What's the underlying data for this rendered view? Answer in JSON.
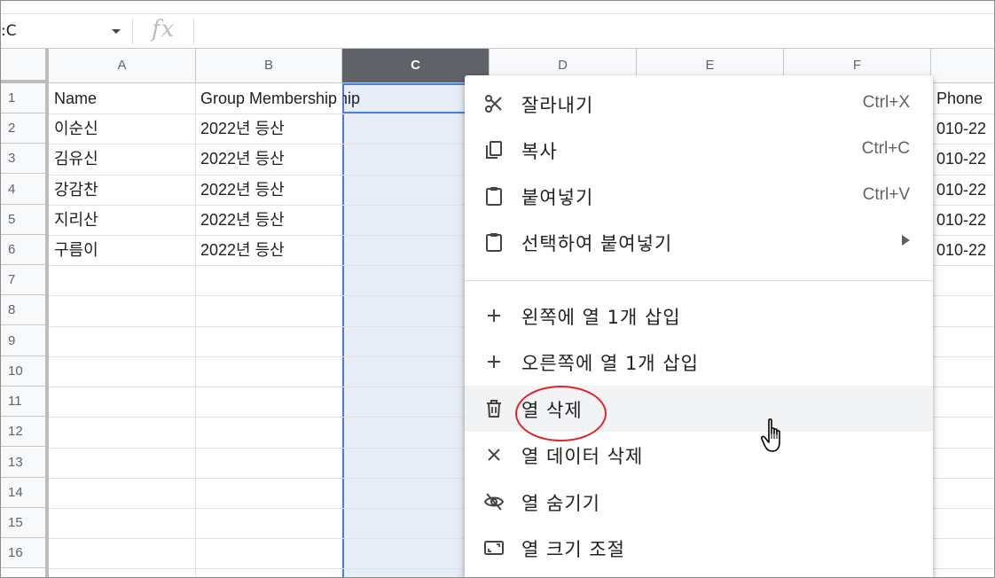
{
  "formula_bar": {
    "name_box": ":C",
    "fx_symbol": "fx"
  },
  "columns": [
    {
      "letter": "A",
      "selected": false
    },
    {
      "letter": "B",
      "selected": false
    },
    {
      "letter": "C",
      "selected": true
    },
    {
      "letter": "D",
      "selected": false
    },
    {
      "letter": "E",
      "selected": false
    },
    {
      "letter": "F",
      "selected": false
    }
  ],
  "rows": [
    "1",
    "2",
    "3",
    "4",
    "5",
    "6",
    "7",
    "8",
    "9",
    "10",
    "11",
    "12",
    "13",
    "14",
    "15",
    "16"
  ],
  "cells": {
    "header_a": "Name",
    "header_b": "Group Membership",
    "header_g": "Phone",
    "data": [
      {
        "name": "이순신",
        "group": "2022년 등산",
        "phone": "010-22"
      },
      {
        "name": "김유신",
        "group": "2022년 등산",
        "phone": "010-22"
      },
      {
        "name": "강감찬",
        "group": "2022년 등산",
        "phone": "010-22"
      },
      {
        "name": "지리산",
        "group": "2022년 등산",
        "phone": "010-22"
      },
      {
        "name": "구름이",
        "group": "2022년 등산",
        "phone": "010-22"
      }
    ]
  },
  "context_menu": {
    "items": [
      {
        "label": "잘라내기",
        "shortcut": "Ctrl+X",
        "icon": "scissors-icon"
      },
      {
        "label": "복사",
        "shortcut": "Ctrl+C",
        "icon": "copy-icon"
      },
      {
        "label": "붙여넣기",
        "shortcut": "Ctrl+V",
        "icon": "clipboard-icon"
      },
      {
        "label": "선택하여 붙여넣기",
        "shortcut": "",
        "icon": "clipboard-icon",
        "submenu": true
      },
      {
        "label": "왼쪽에 열 1개 삽입",
        "shortcut": "",
        "icon": "plus-icon"
      },
      {
        "label": "오른쪽에 열 1개 삽입",
        "shortcut": "",
        "icon": "plus-icon"
      },
      {
        "label": "열 삭제",
        "shortcut": "",
        "icon": "trash-icon",
        "highlighted": true
      },
      {
        "label": "열 데이터 삭제",
        "shortcut": "",
        "icon": "close-icon"
      },
      {
        "label": "열 숨기기",
        "shortcut": "",
        "icon": "eye-off-icon"
      },
      {
        "label": "열 크기 조절",
        "shortcut": "",
        "icon": "resize-icon"
      }
    ]
  },
  "colors": {
    "selection_fill": "#e8eef8",
    "selection_border": "#4a7ee0",
    "selected_header": "#5f6368",
    "annotation_circle": "#e0252c"
  }
}
